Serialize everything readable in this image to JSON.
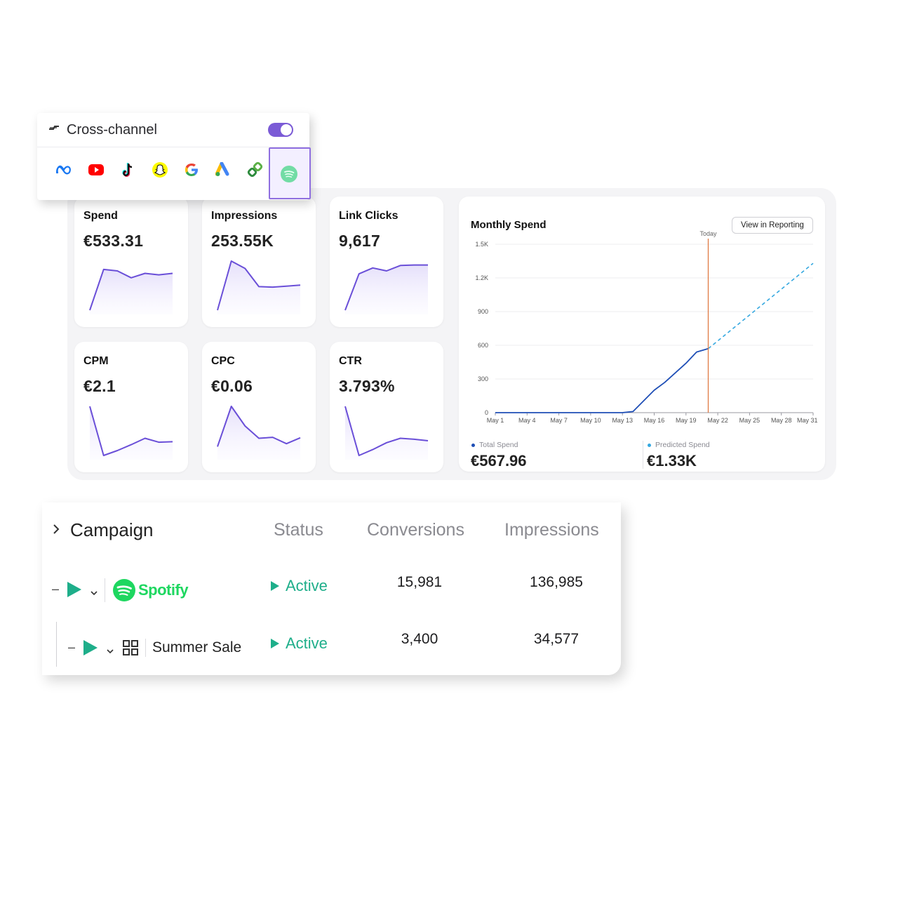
{
  "colors": {
    "accent_purple": "#7b5bd6",
    "sparkline": "#6a4fd8",
    "total_spend_line": "#1f4fb6",
    "predicted_line": "#35a8e0",
    "today_line": "#e07a44",
    "active_green": "#1eae8a",
    "spotify_green": "#1ed760"
  },
  "cross_channel": {
    "title": "Cross-channel",
    "toggle_on": true,
    "channels": [
      "meta-icon",
      "youtube-icon",
      "tiktok-icon",
      "snapchat-icon",
      "google-icon",
      "google-ads-icon",
      "linked-icon",
      "spotify-icon"
    ],
    "selected_channel": "spotify-icon"
  },
  "kpis": [
    {
      "label": "Spend",
      "value": "€533.31",
      "trend": [
        0.0,
        0.83,
        0.8,
        0.66,
        0.75,
        0.72,
        0.75
      ]
    },
    {
      "label": "Impressions",
      "value": "253.55K",
      "trend": [
        0.0,
        1.0,
        0.85,
        0.48,
        0.47,
        0.49,
        0.51
      ]
    },
    {
      "label": "Link Clicks",
      "value": "9,617",
      "trend": [
        0.0,
        0.74,
        0.86,
        0.8,
        0.91,
        0.92,
        0.92
      ]
    },
    {
      "label": "CPM",
      "value": "€2.1",
      "trend": [
        1.0,
        0.0,
        0.1,
        0.22,
        0.35,
        0.27,
        0.28
      ]
    },
    {
      "label": "CPC",
      "value": "€0.06",
      "trend": [
        0.18,
        1.0,
        0.6,
        0.35,
        0.37,
        0.24,
        0.36
      ]
    },
    {
      "label": "CTR",
      "value": "3.793%",
      "trend": [
        1.0,
        0.0,
        0.12,
        0.26,
        0.35,
        0.33,
        0.3
      ]
    }
  ],
  "monthly_spend": {
    "title": "Monthly Spend",
    "button_label": "View in Reporting",
    "today_label": "Today",
    "legend_total_label": "Total Spend",
    "legend_total_value": "€567.96",
    "legend_predicted_label": "Predicted Spend",
    "legend_predicted_value": "€1.33K"
  },
  "chart_data": {
    "type": "line",
    "title": "Monthly Spend",
    "y_ticks": [
      "0",
      "300",
      "600",
      "900",
      "1.2K",
      "1.5K"
    ],
    "ylim": [
      0,
      1500
    ],
    "x_ticks": [
      "May 1",
      "May 4",
      "May 7",
      "May 10",
      "May 13",
      "May 16",
      "May 19",
      "May 22",
      "May 25",
      "May 28",
      "May 31"
    ],
    "xlim": [
      1,
      31
    ],
    "today_x": 21.1,
    "series": [
      {
        "name": "Total Spend",
        "x": [
          1,
          4,
          7,
          10,
          13,
          14,
          16,
          17,
          19,
          20,
          21.1
        ],
        "y": [
          0,
          0,
          0,
          0,
          0,
          10,
          200,
          270,
          440,
          540,
          570
        ]
      },
      {
        "name": "Predicted Spend",
        "x": [
          21.1,
          31
        ],
        "y": [
          570,
          1330
        ]
      }
    ]
  },
  "campaign_table": {
    "headers": {
      "campaign": "Campaign",
      "status": "Status",
      "conversions": "Conversions",
      "impressions": "Impressions"
    },
    "rows": [
      {
        "name": "Spotify",
        "status": "Active",
        "conversions": "15,981",
        "impressions": "136,985"
      },
      {
        "name": "Summer Sale",
        "status": "Active",
        "conversions": "3,400",
        "impressions": "34,577"
      }
    ]
  }
}
